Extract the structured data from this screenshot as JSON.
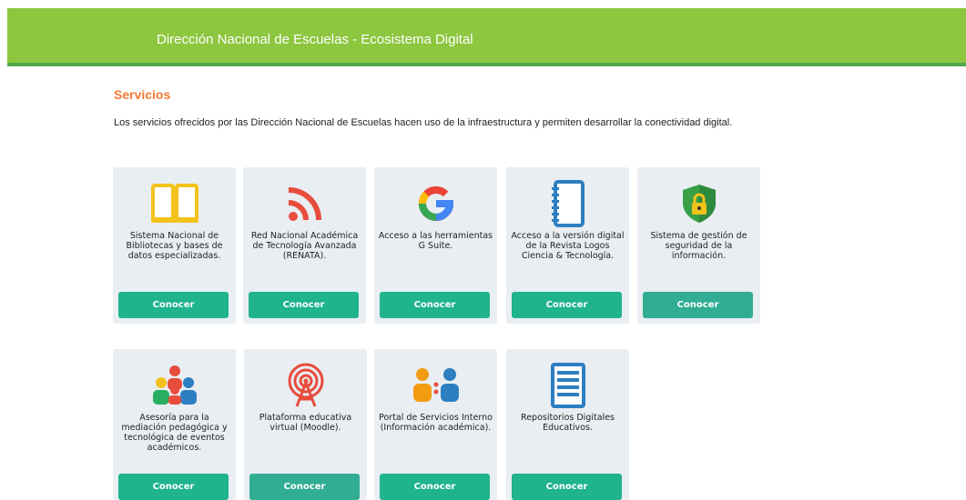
{
  "header": {
    "title": "Dirección Nacional de Escuelas - Ecosistema Digital"
  },
  "section": {
    "title": "Servicios",
    "intro": "Los servicios ofrecidos por las Dirección Nacional de Escuelas hacen uso de la infraestructura y permiten desarrollar la conectividad digital."
  },
  "colors": {
    "header_bg": "#8dc63f",
    "header_border": "#4ca84a",
    "section_title": "#f47a35",
    "button": "#1fb38e",
    "card_bg": "#e9eef3"
  },
  "cards": [
    {
      "icon": "book-icon",
      "desc": "Sistema Nacional de Bibliotecas y bases de datos especializadas.",
      "button": "Conocer"
    },
    {
      "icon": "rss-icon",
      "desc": "Red Nacional Académica de Tecnología Avanzada (RENATA).",
      "button": "Conocer"
    },
    {
      "icon": "google-icon",
      "desc": "Acceso a las herramientas G Suite.",
      "button": "Conocer"
    },
    {
      "icon": "notebook-icon",
      "desc": "Acceso a la versión digital de la Revista Logos Ciencia & Tecnología.",
      "button": "Conocer"
    },
    {
      "icon": "security-shield-icon",
      "desc": "Sistema de gestión de seguridad de la información.",
      "button": "Conocer"
    },
    {
      "icon": "people-group-icon",
      "desc": "Asesoría para la mediación pedagógica y tecnológica de eventos académicos.",
      "button": "Conocer"
    },
    {
      "icon": "broadcast-antenna-icon",
      "desc": "Plataforma educativa virtual (Moodle).",
      "button": "Conocer"
    },
    {
      "icon": "people-pair-icon",
      "desc": "Portal de Servicios Interno (Información académica).",
      "button": "Conocer"
    },
    {
      "icon": "list-document-icon",
      "desc": "Repositorios Digitales Educativos.",
      "button": "Conocer"
    }
  ]
}
